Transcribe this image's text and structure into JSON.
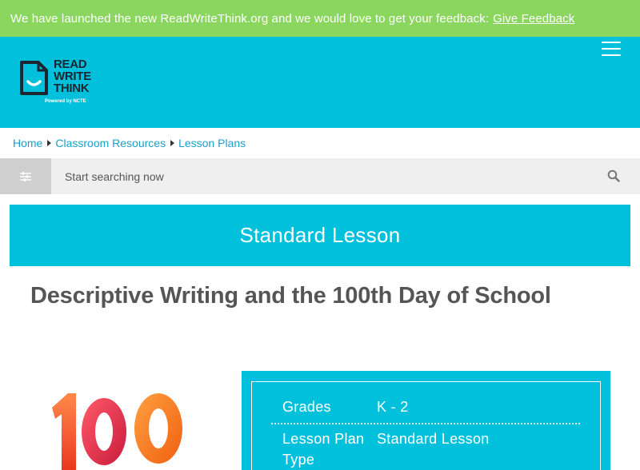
{
  "banner": {
    "message": "We have launched the new ReadWriteThink.org and we would love to get your feedback:",
    "link_label": "Give Feedback"
  },
  "logo": {
    "line1": "READ",
    "line2": "WRITE",
    "line3": "THINK",
    "tagline": "Powered by NCTE"
  },
  "breadcrumb": [
    "Home",
    "Classroom Resources",
    "Lesson Plans"
  ],
  "search": {
    "placeholder": "Start searching now"
  },
  "lesson_type_banner": "Standard Lesson",
  "page_title": "Descriptive Writing and the 100th Day of School",
  "info": [
    {
      "key": "Grades",
      "value": "K - 2"
    },
    {
      "key": "Lesson Plan Type",
      "value": "Standard Lesson"
    }
  ],
  "colors": {
    "banner_green": "#8bd65f",
    "brand_cyan": "#00c0dc",
    "link_blue": "#1aa0c8",
    "title_gray": "#555555"
  }
}
